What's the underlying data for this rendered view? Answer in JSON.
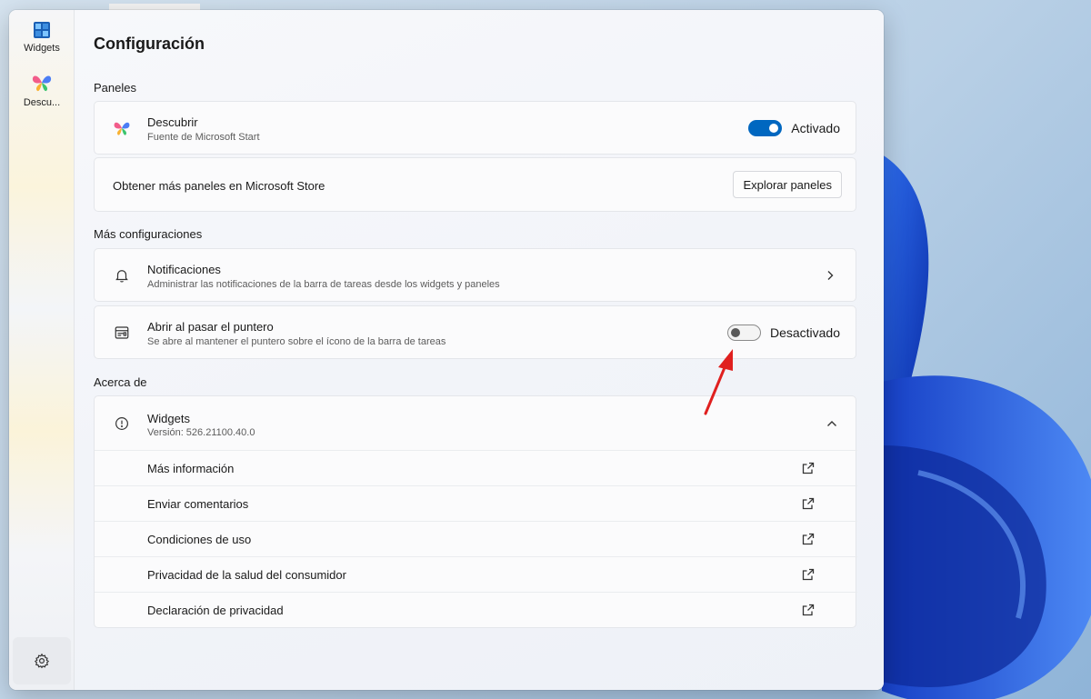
{
  "rail": {
    "items": [
      {
        "label": "Widgets",
        "icon": "widgets-icon"
      },
      {
        "label": "Descu...",
        "icon": "butterfly-icon"
      }
    ],
    "settings_icon": "gear-icon"
  },
  "page": {
    "title": "Configuración"
  },
  "sections": {
    "paneles": "Paneles",
    "mas": "Más configuraciones",
    "acerca": "Acerca de"
  },
  "descubrir": {
    "title": "Descubrir",
    "subtitle": "Fuente de Microsoft Start",
    "toggle_state": "Activado",
    "toggle_on": true
  },
  "store": {
    "text": "Obtener más paneles en Microsoft Store",
    "button": "Explorar paneles"
  },
  "notificaciones": {
    "title": "Notificaciones",
    "subtitle": "Administrar las notificaciones de la barra de tareas desde los widgets y paneles"
  },
  "abrir": {
    "title": "Abrir al pasar el puntero",
    "subtitle": "Se abre al mantener el puntero sobre el ícono de la barra de tareas",
    "toggle_state": "Desactivado",
    "toggle_on": false
  },
  "about": {
    "title": "Widgets",
    "version": "Versión: 526.21100.40.0",
    "links": [
      "Más información",
      "Enviar comentarios",
      "Condiciones de uso",
      "Privacidad de la salud del consumidor",
      "Declaración de privacidad"
    ]
  },
  "colors": {
    "accent": "#0067c0",
    "annotation_arrow": "#e0201f"
  }
}
